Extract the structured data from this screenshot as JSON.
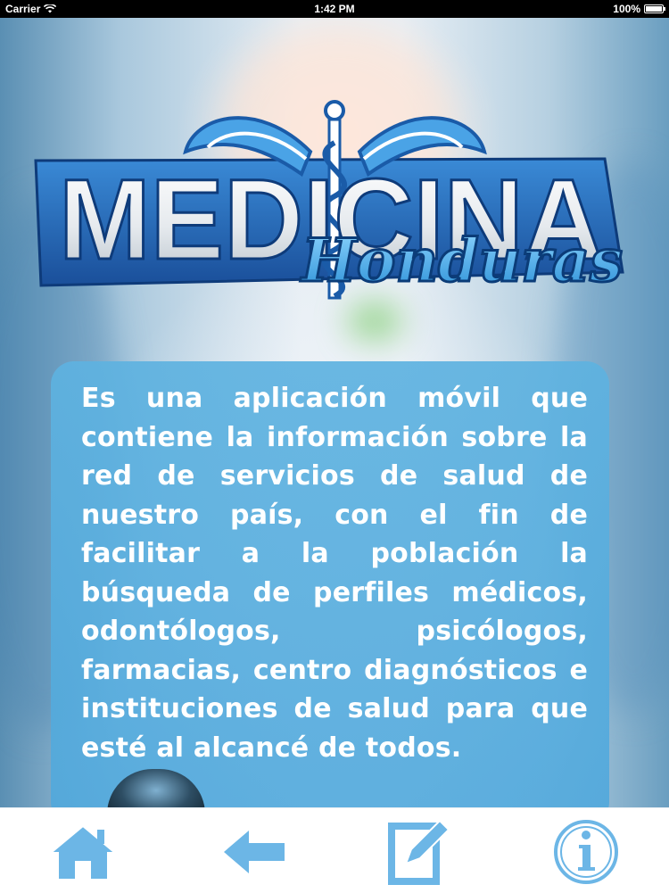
{
  "status_bar": {
    "carrier": "Carrier",
    "time": "1:42 PM",
    "battery": "100%",
    "battery_level": 1.0
  },
  "logo": {
    "word_main": "MEDICINA",
    "word_script": "Honduras",
    "icon": "caduceus-icon"
  },
  "info": {
    "text": "Es una aplicación móvil que contiene la  información sobre la red de servicios de salud de nuestro país, con el fin de facilitar a la población la búsqueda de perfiles médicos, odontólogos, psicólogos, farmacias, centro diagnósticos e instituciones de salud para que esté al alcancé de todos."
  },
  "tabbar": {
    "items": [
      {
        "icon": "home-icon"
      },
      {
        "icon": "back-arrow-icon"
      },
      {
        "icon": "edit-note-icon"
      },
      {
        "icon": "info-icon"
      }
    ]
  },
  "colors": {
    "accent": "#5ab0df",
    "card": "#5eb2e0",
    "logo_blue": "#1f6fc0",
    "icon_blue": "#6cb6e6"
  }
}
